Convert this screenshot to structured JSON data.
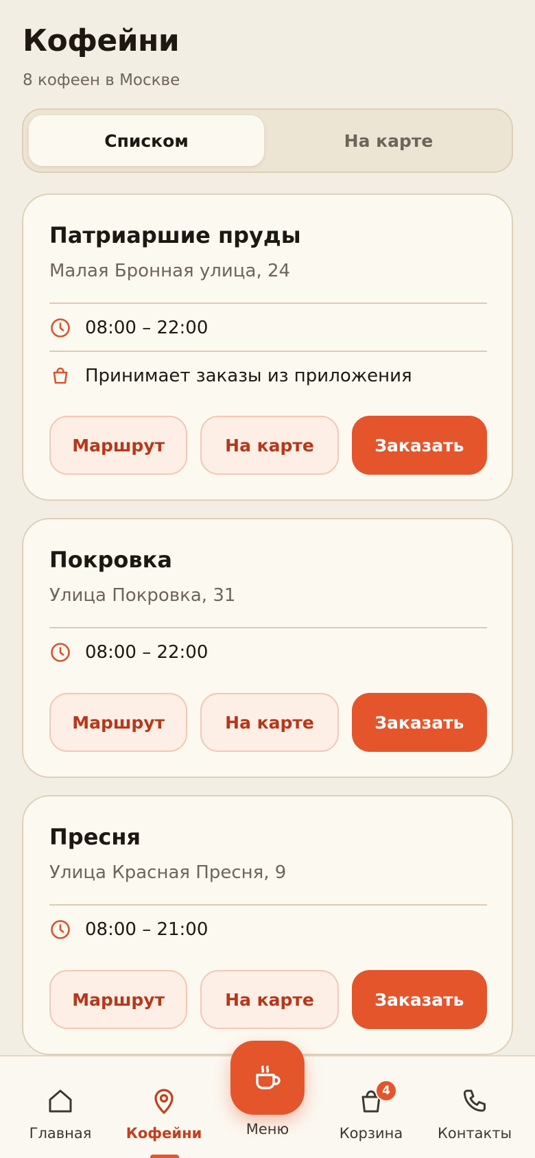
{
  "header": {
    "title": "Кофейни",
    "subtitle": "8 кофеен в Москве"
  },
  "view_toggle": {
    "options": [
      "Списком",
      "На карте"
    ],
    "selected": "Списком"
  },
  "shops": [
    {
      "name": "Патриаршие пруды",
      "address": "Малая Бронная улица, 24",
      "hours": "08:00 – 22:00",
      "app_orders": "Принимает заказы из приложения",
      "route_label": "Маршрут",
      "map_label": "На карте",
      "order_label": "Заказать"
    },
    {
      "name": "Покровка",
      "address": "Улица Покровка, 31",
      "hours": "08:00 – 22:00",
      "route_label": "Маршрут",
      "map_label": "На карте",
      "order_label": "Заказать"
    },
    {
      "name": "Пресня",
      "address": "Улица Красная Пресня, 9",
      "hours": "08:00 – 21:00",
      "route_label": "Маршрут",
      "map_label": "На карте",
      "order_label": "Заказать"
    }
  ],
  "tabbar": {
    "items": [
      {
        "label": "Главная",
        "icon": "home-icon"
      },
      {
        "label": "Кофейни",
        "icon": "location-pin-icon"
      },
      {
        "label": "Меню",
        "icon": "coffee-cup-icon"
      },
      {
        "label": "Корзина",
        "icon": "shopping-bag-icon"
      },
      {
        "label": "Контакты",
        "icon": "phone-icon"
      }
    ],
    "active": "Кофейни",
    "cart_count": "4"
  },
  "colors": {
    "accent": "#E4552C",
    "background": "#F3EEE3",
    "card": "#FCF9F1"
  }
}
